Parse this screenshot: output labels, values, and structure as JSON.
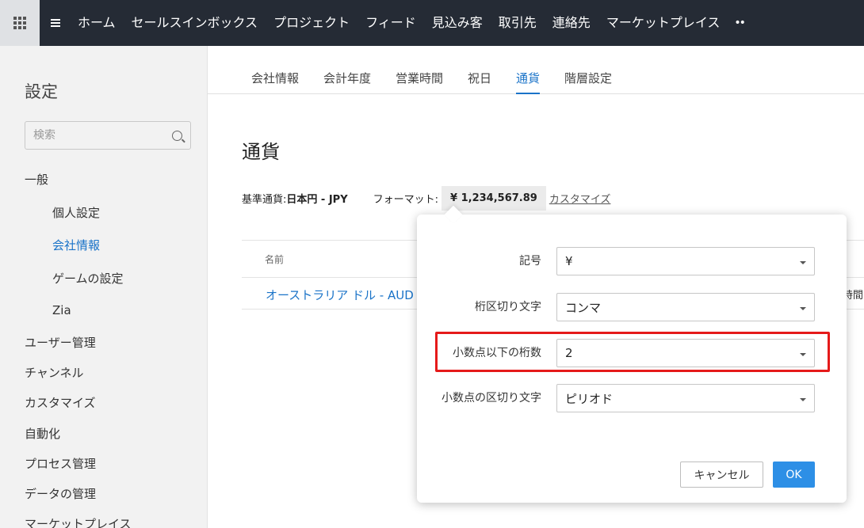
{
  "topnav": {
    "items": [
      "ホーム",
      "セールスインボックス",
      "プロジェクト",
      "フィード",
      "見込み客",
      "取引先",
      "連絡先",
      "マーケットプレイス"
    ],
    "more": "••"
  },
  "sidebar": {
    "title": "設定",
    "search_placeholder": "検索",
    "items": [
      {
        "label": "一般",
        "level": "top"
      },
      {
        "label": "個人設定",
        "level": "sub"
      },
      {
        "label": "会社情報",
        "level": "sub",
        "active": true
      },
      {
        "label": "ゲームの設定",
        "level": "sub"
      },
      {
        "label": "Zia",
        "level": "sub"
      },
      {
        "label": "ユーザー管理",
        "level": "top"
      },
      {
        "label": "チャンネル",
        "level": "top"
      },
      {
        "label": "カスタマイズ",
        "level": "top"
      },
      {
        "label": "自動化",
        "level": "top"
      },
      {
        "label": "プロセス管理",
        "level": "top"
      },
      {
        "label": "データの管理",
        "level": "top"
      },
      {
        "label": "マーケットプレイス",
        "level": "top"
      }
    ]
  },
  "tabs": [
    {
      "label": "会社情報"
    },
    {
      "label": "会計年度"
    },
    {
      "label": "営業時間"
    },
    {
      "label": "祝日"
    },
    {
      "label": "通貨",
      "active": true
    },
    {
      "label": "階層設定"
    }
  ],
  "main": {
    "title": "通貨",
    "base_currency_label": "基準通貨: ",
    "base_currency_value": "日本円 - JPY",
    "format_label": "フォーマット: ",
    "format_value": "¥ 1,234,567.89",
    "customize_link": "カスタマイズ",
    "table": {
      "header_name": "名前",
      "row_name": "オーストラリア ドル - AUD",
      "row_cut_text": "時間"
    }
  },
  "popup": {
    "fields": [
      {
        "label": "記号",
        "value": "¥"
      },
      {
        "label": "桁区切り文字",
        "value": "コンマ"
      },
      {
        "label": "小数点以下の桁数",
        "value": "2"
      },
      {
        "label": "小数点の区切り文字",
        "value": "ピリオド"
      }
    ],
    "cancel": "キャンセル",
    "ok": "OK"
  },
  "colors": {
    "topbar": "#252b35",
    "accent": "#1a73c8",
    "ok_button": "#2d8fe6",
    "highlight": "#e51a1a"
  }
}
